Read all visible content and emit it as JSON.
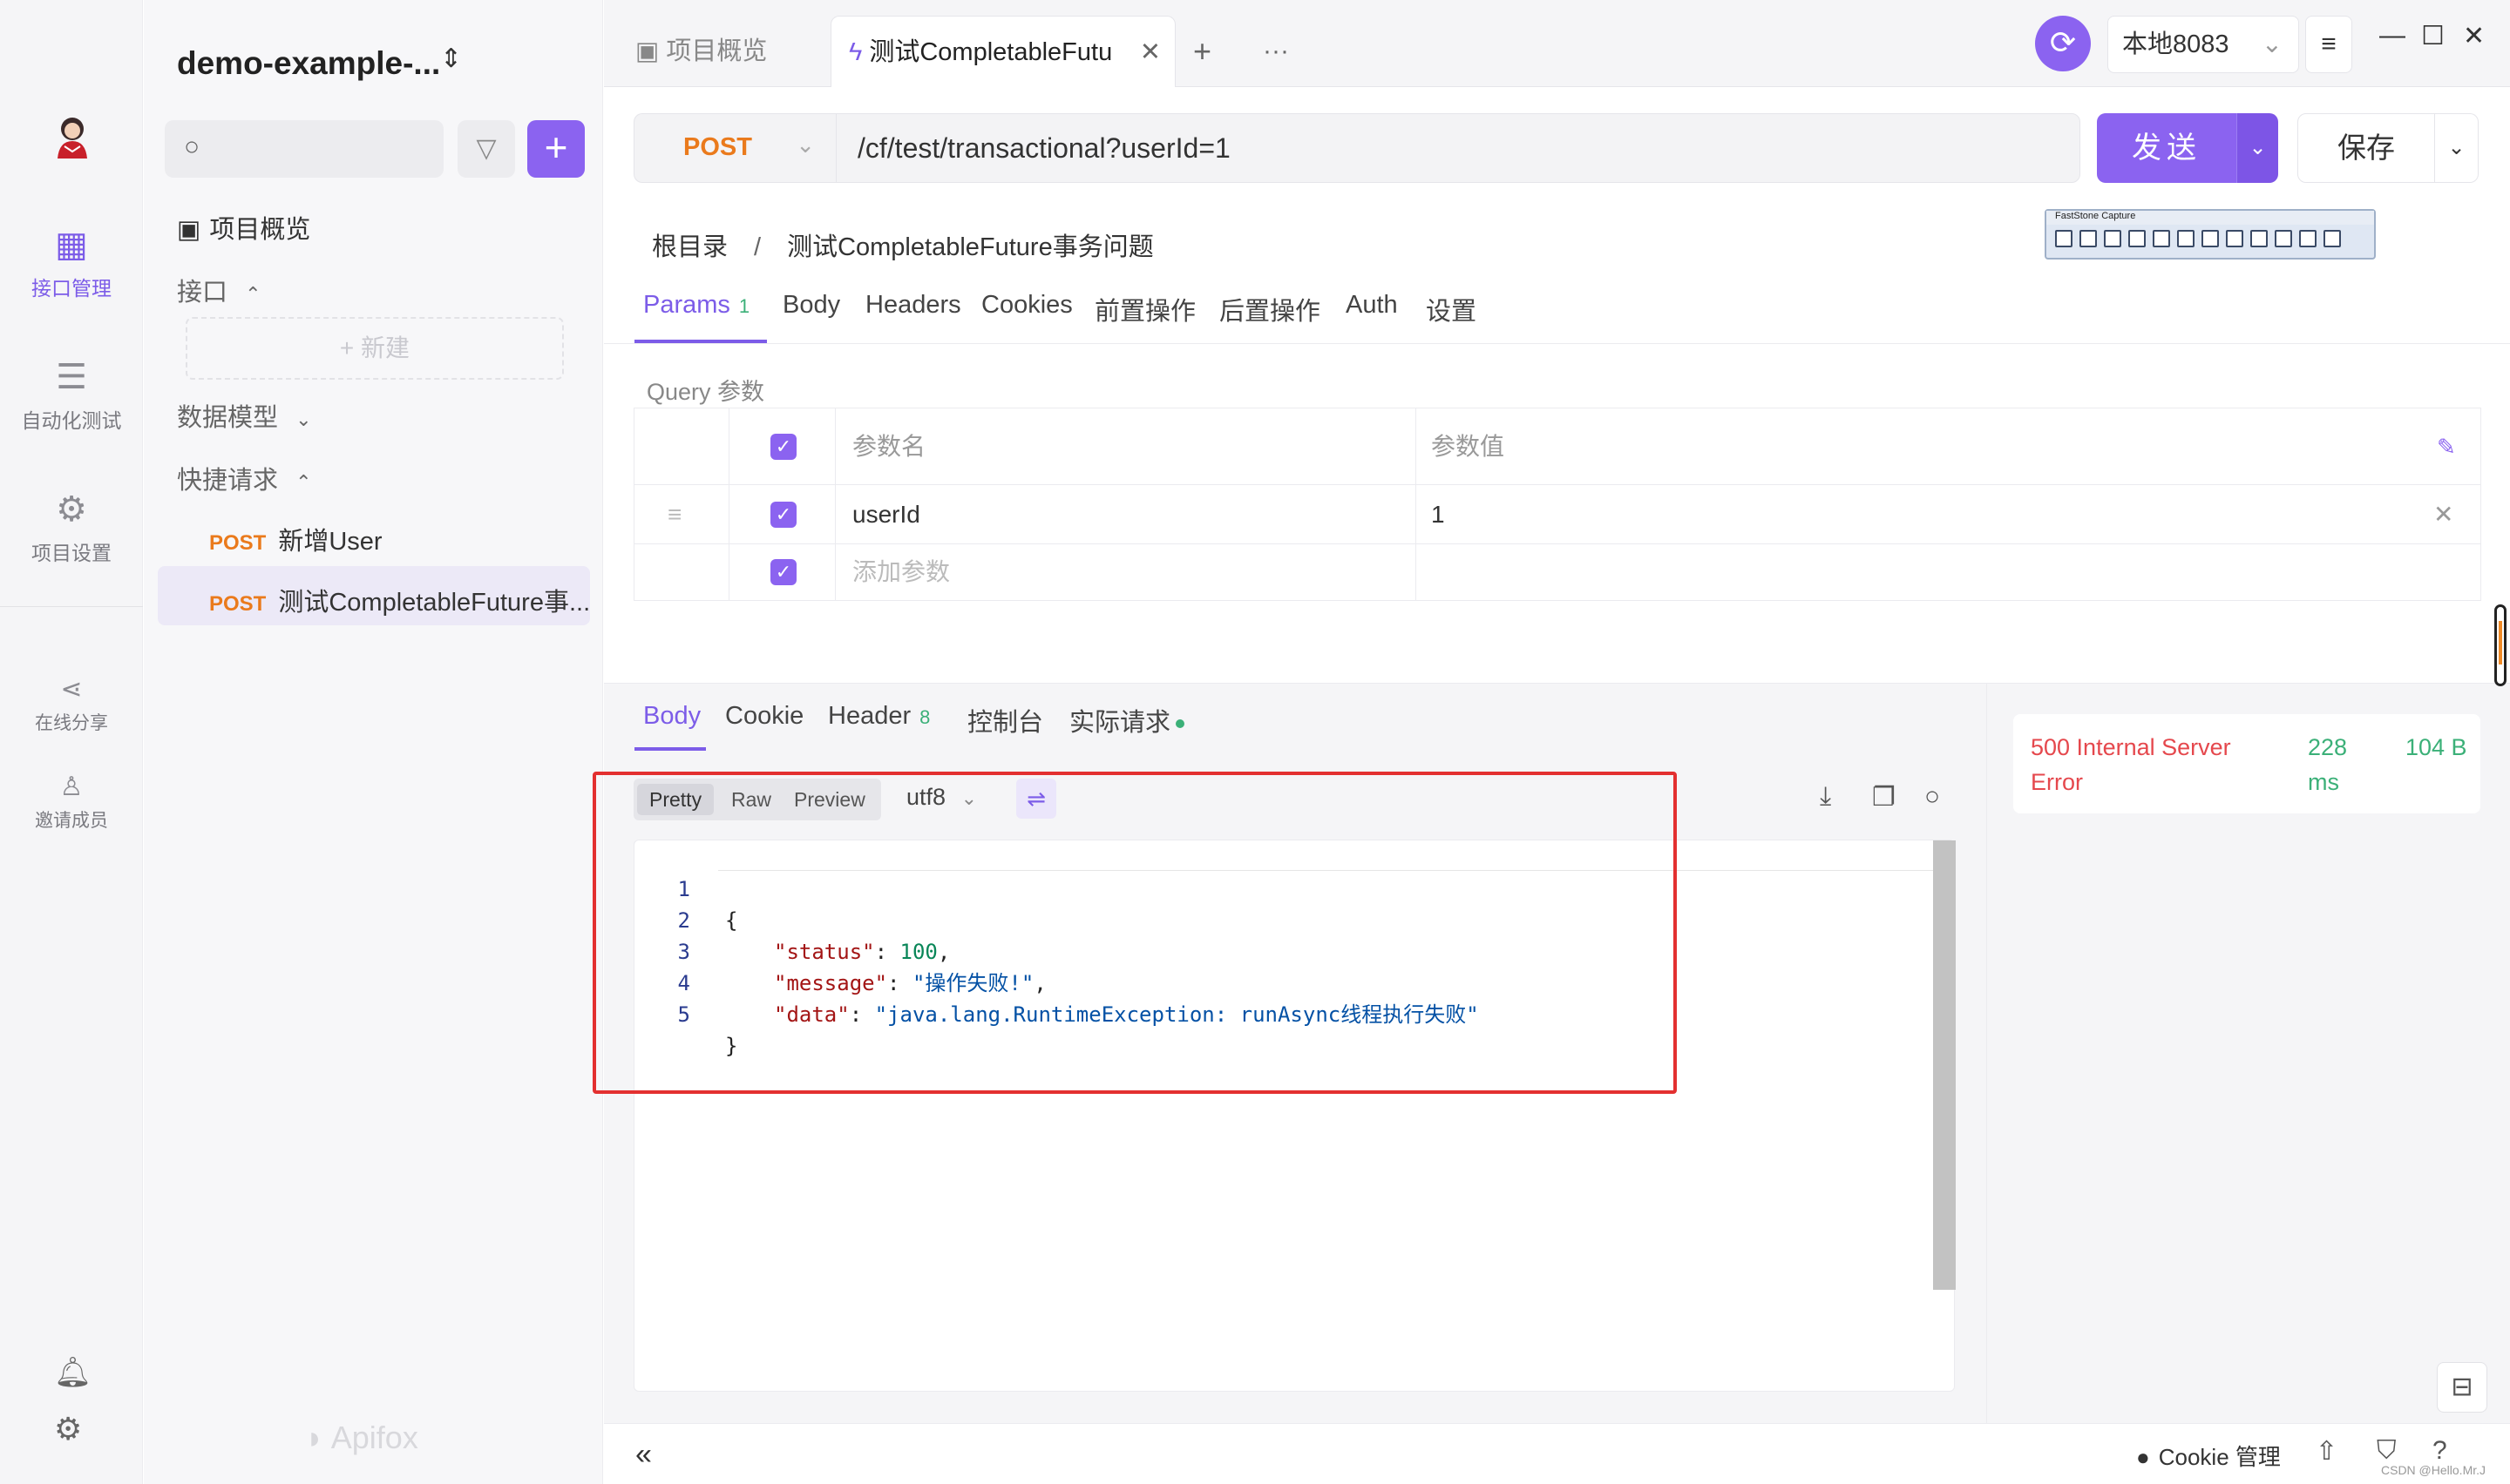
{
  "rail": {
    "items": [
      {
        "label": "接口管理",
        "icon": "api-management-icon",
        "active": true
      },
      {
        "label": "自动化测试",
        "icon": "automation-test-icon"
      },
      {
        "label": "项目设置",
        "icon": "project-settings-icon"
      },
      {
        "label": "在线分享",
        "icon": "share-icon"
      },
      {
        "label": "邀请成员",
        "icon": "invite-member-icon"
      }
    ]
  },
  "sidebar": {
    "project_title": "demo-example-...",
    "overview_label": "项目概览",
    "interfaces_label": "接口",
    "new_label": "+ 新建",
    "data_model_label": "数据模型",
    "quick_request_label": "快捷请求",
    "requests": [
      {
        "method": "POST",
        "name": "新增User"
      },
      {
        "method": "POST",
        "name": "测试CompletableFuture事..."
      }
    ],
    "logo_text": "Apifox"
  },
  "tabbar": {
    "overview_tab": "项目概览",
    "active_tab": "测试CompletableFutu",
    "add": "+",
    "more": "···",
    "env": "本地8083"
  },
  "request": {
    "method": "POST",
    "url": "/cf/test/transactional?userId=1",
    "send_label": "发送",
    "save_label": "保存"
  },
  "breadcrumb": {
    "root": "根目录",
    "sep": "/",
    "current": "测试CompletableFuture事务问题"
  },
  "faststone": {
    "title": "FastStone Capture"
  },
  "req_tabs": [
    {
      "label": "Params",
      "count": "1"
    },
    {
      "label": "Body"
    },
    {
      "label": "Headers"
    },
    {
      "label": "Cookies"
    },
    {
      "label": "前置操作"
    },
    {
      "label": "后置操作"
    },
    {
      "label": "Auth"
    },
    {
      "label": "设置"
    }
  ],
  "params": {
    "section_label": "Query 参数",
    "col_name": "参数名",
    "col_value": "参数值",
    "rows": [
      {
        "name": "userId",
        "value": "1"
      }
    ],
    "add_placeholder": "添加参数"
  },
  "resp_tabs": [
    {
      "label": "Body"
    },
    {
      "label": "Cookie"
    },
    {
      "label": "Header",
      "count": "8"
    },
    {
      "label": "控制台"
    },
    {
      "label": "实际请求"
    }
  ],
  "view": {
    "modes": [
      "Pretty",
      "Raw",
      "Preview"
    ],
    "active_mode": "Pretty",
    "encoding": "utf8"
  },
  "response": {
    "lines": [
      {
        "no": "1",
        "text": "{"
      },
      {
        "no": "2",
        "key": "\"status\"",
        "value": "100",
        "type": "number",
        "tail": ","
      },
      {
        "no": "3",
        "key": "\"message\"",
        "value": "\"操作失败!\"",
        "type": "string",
        "tail": ","
      },
      {
        "no": "4",
        "key": "\"data\"",
        "value": "\"java.lang.RuntimeException: runAsync线程执行失败\"",
        "type": "string",
        "tail": ""
      },
      {
        "no": "5",
        "text": "}"
      }
    ],
    "status": "500 Internal Server Error",
    "time": "228 ms",
    "size": "104 B"
  },
  "bottombar": {
    "collapse": "«",
    "cookie_manager": "Cookie 管理",
    "watermark": "CSDN @Hello.Mr.J"
  },
  "colors": {
    "accent": "#8b63f0",
    "method_post": "#ea7a1c",
    "error": "#e5484d",
    "success": "#3bb078",
    "highlight": "#e33030"
  }
}
